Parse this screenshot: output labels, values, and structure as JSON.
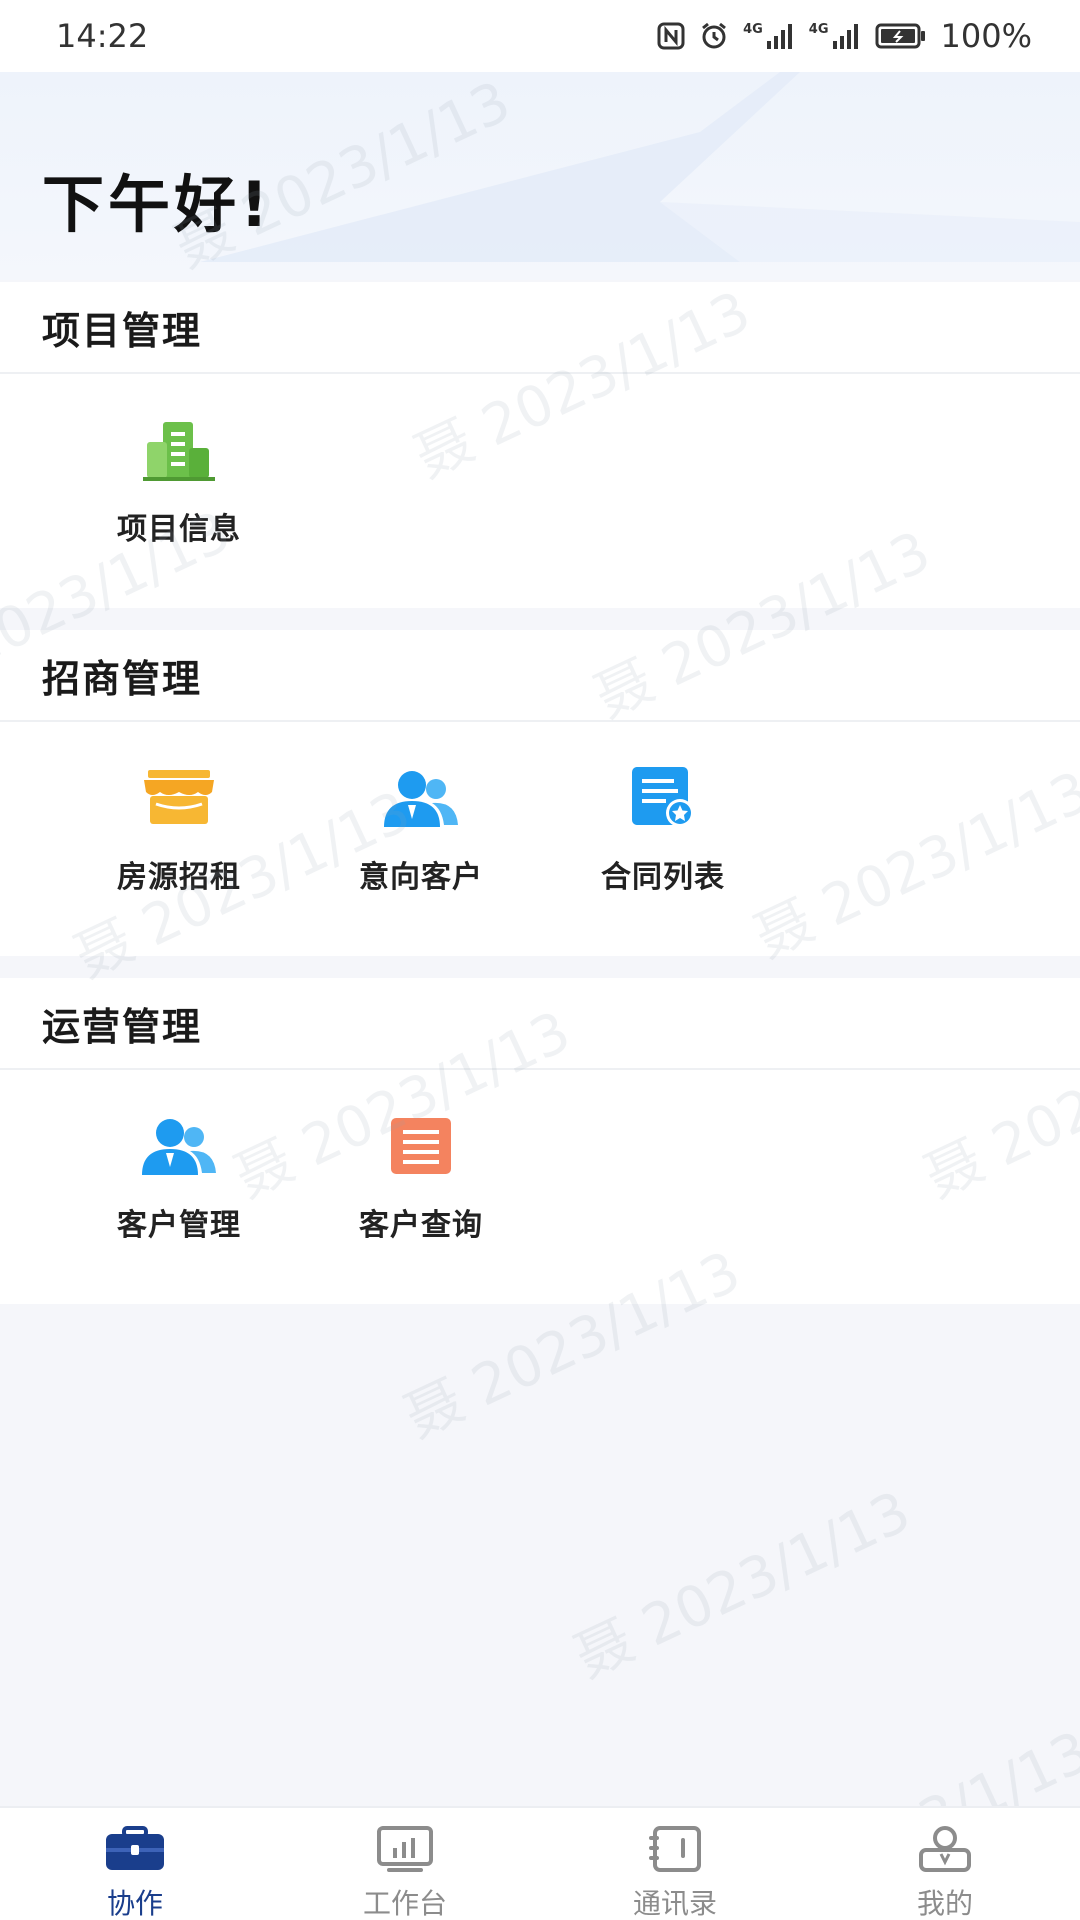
{
  "status_bar": {
    "time": "14:22",
    "signal_1": "4G",
    "signal_2": "4G",
    "battery": "100%",
    "icons": [
      "nfc-icon",
      "alarm-icon",
      "signal-4g-icon",
      "signal-4g-icon",
      "battery-icon"
    ]
  },
  "header": {
    "greeting": "下午好!"
  },
  "watermark": "聂 2023/1/13",
  "sections": [
    {
      "title": "项目管理",
      "items": [
        {
          "label": "项目信息",
          "icon": "building-icon",
          "color": "#6cc04a"
        }
      ]
    },
    {
      "title": "招商管理",
      "items": [
        {
          "label": "房源招租",
          "icon": "storefront-icon",
          "color": "#f5a623"
        },
        {
          "label": "意向客户",
          "icon": "users-icon",
          "color": "#1e9bf0"
        },
        {
          "label": "合同列表",
          "icon": "contract-list-icon",
          "color": "#1e9bf0"
        }
      ]
    },
    {
      "title": "运营管理",
      "items": [
        {
          "label": "客户管理",
          "icon": "users-icon",
          "color": "#1e9bf0"
        },
        {
          "label": "客户查询",
          "icon": "document-list-icon",
          "color": "#f4835f"
        }
      ]
    }
  ],
  "tab_bar": {
    "tabs": [
      {
        "label": "协作",
        "icon": "briefcase-icon",
        "active": true
      },
      {
        "label": "工作台",
        "icon": "dashboard-icon",
        "active": false
      },
      {
        "label": "通讯录",
        "icon": "contacts-book-icon",
        "active": false
      },
      {
        "label": "我的",
        "icon": "user-profile-icon",
        "active": false
      }
    ],
    "active_color": "#1a3e8c",
    "inactive_color": "#8c8c8c"
  }
}
